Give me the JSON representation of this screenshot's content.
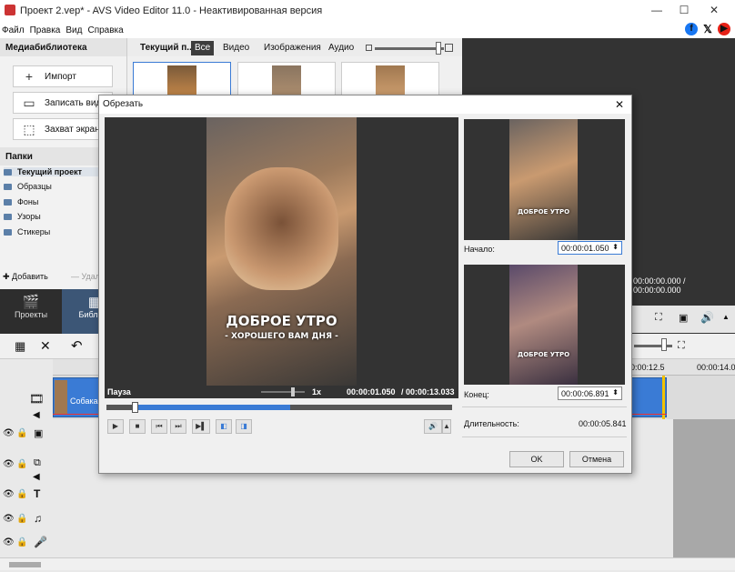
{
  "app": {
    "title": "Проект 2.vep* - AVS Video Editor 11.0 - Неактивированная версия",
    "menu": [
      "Файл",
      "Правка",
      "Вид",
      "Справка"
    ]
  },
  "media": {
    "header": "Медиабиблиотека",
    "import": "Импорт",
    "record": "Записать виде",
    "capture": "Захват экрана"
  },
  "folders": {
    "header": "Папки",
    "items": [
      "Текущий проект",
      "Образцы",
      "Фоны",
      "Узоры",
      "Стикеры"
    ],
    "add": "Добавить",
    "remove": "Удал"
  },
  "tabs": {
    "current": "Текущий п...",
    "all": "Все",
    "video": "Видео",
    "images": "Изображения",
    "audio": "Аудио"
  },
  "bottomnav": {
    "projects": "Проекты",
    "library": "Библиот"
  },
  "rightpanel": {
    "time": "00:00:00.000 / 00:00:00.000"
  },
  "timeline": {
    "ruler": [
      "00:00:12.5",
      "00:00:14.0"
    ],
    "clip": "Собака"
  },
  "dialog": {
    "title": "Обрезать",
    "state": "Пауза",
    "speed": "1x",
    "time_current": "00:00:01.050",
    "time_total": "/ 00:00:13.033",
    "start_label": "Начало:",
    "start_value": "00:00:01.050",
    "end_label": "Конец:",
    "end_value": "00:00:06.891",
    "duration_label": "Длительность:",
    "duration_value": "00:00:05.841",
    "ok": "OK",
    "cancel": "Отмена",
    "caption1": "ДОБРОЕ УТРО",
    "caption2": "- ХОРОШЕГО ВАМ ДНЯ -",
    "caption_small": "ДОБРОЕ УТРО"
  },
  "colors": {
    "accent": "#3a7bd5",
    "facebook": "#1877f2",
    "youtube": "#e62117",
    "x": "#000000"
  }
}
